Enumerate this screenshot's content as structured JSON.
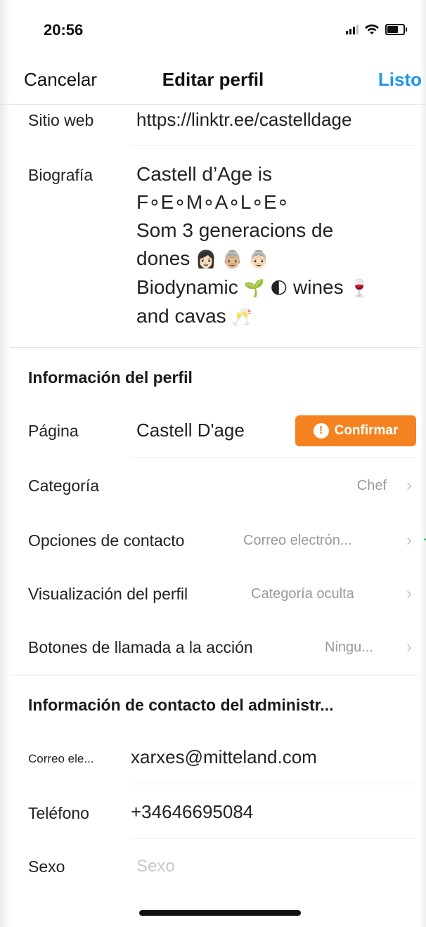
{
  "status_bar": {
    "time": "20:56",
    "icons": [
      "signal-icon",
      "wifi-icon",
      "battery-icon"
    ]
  },
  "nav": {
    "cancel": "Cancelar",
    "title": "Editar perfil",
    "done": "Listo"
  },
  "fields": {
    "website": {
      "label": "Sitio web",
      "value": "https://linktr.ee/castelldage"
    },
    "bio": {
      "label": "Biografía",
      "lines": [
        "Castell d’Age is",
        "F∘E∘M∘A∘L∘E∘",
        "Som 3 generacions de",
        "dones",
        "Biodynamic",
        "wines",
        "and cavas"
      ],
      "emojis": [
        "👩🏻",
        "👵🏼",
        "👵🏻",
        "🌱",
        "🌓",
        "🍷",
        "🥂"
      ]
    }
  },
  "profile_info": {
    "header": "Información del perfil",
    "page": {
      "label": "Página",
      "value": "Castell D'age",
      "button": "Confirmar"
    },
    "rows": [
      {
        "label": "Categoría",
        "value": "Chef"
      },
      {
        "label": "Opciones de contacto",
        "value": "Correo electrón..."
      },
      {
        "label": "Visualización del perfil",
        "value": "Categoría oculta"
      },
      {
        "label": "Botones de llamada a la acción",
        "value": "Ningu..."
      }
    ]
  },
  "admin_contact": {
    "header": "Información de contacto del administr...",
    "email": {
      "label": "Correo ele...",
      "value": "xarxes@mitteland.com"
    },
    "phone": {
      "label": "Teléfono",
      "value": "+34646695084"
    },
    "gender": {
      "label": "Sexo",
      "placeholder": "Sexo"
    }
  },
  "colors": {
    "accent_blue": "#1e96f0",
    "confirm_orange": "#f58220",
    "secondary_text": "#9a9a9a"
  }
}
